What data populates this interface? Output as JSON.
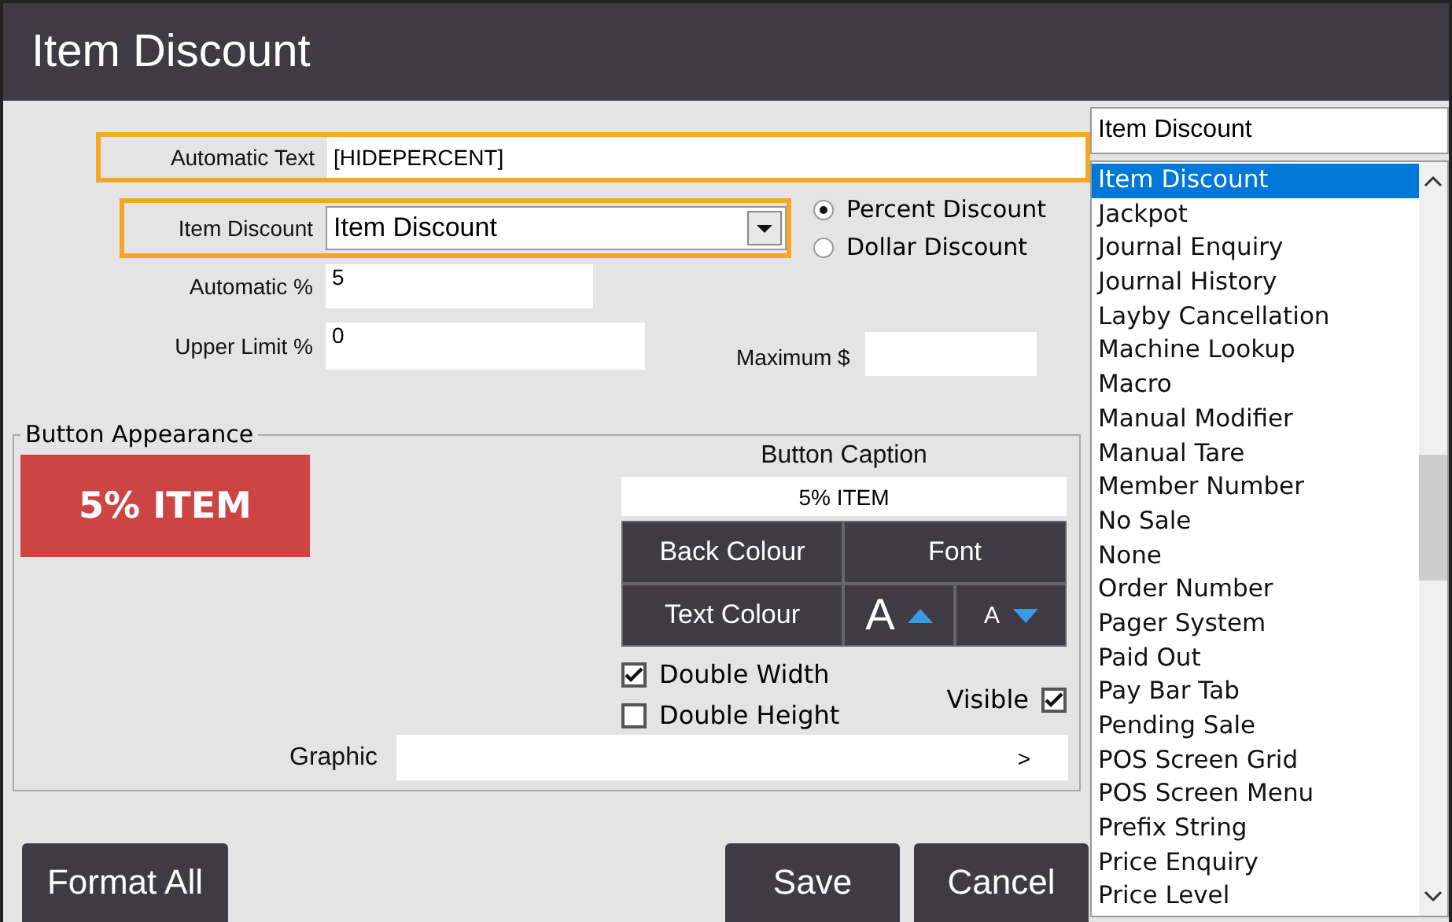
{
  "window": {
    "title": "Item Discount"
  },
  "automatic_text": {
    "label": "Automatic Text",
    "value": "[HIDEPERCENT]",
    "highlighted": true
  },
  "function_select": {
    "label": "Item Discount",
    "value": "Item Discount",
    "highlighted": true
  },
  "discount_type": [
    {
      "label": "Percent Discount",
      "selected": true
    },
    {
      "label": "Dollar Discount",
      "selected": false
    }
  ],
  "automatic_percent": {
    "label": "Automatic %",
    "value": "5"
  },
  "upper_limit": {
    "label": "Upper Limit %",
    "value": "0"
  },
  "maximum": {
    "label": "Maximum $"
  },
  "appearance": {
    "title": "Button Appearance",
    "preview": "5% ITEM",
    "caption_label": "Button Caption",
    "caption": "5% ITEM",
    "buttons": [
      {
        "kind": "text",
        "label": "Back Colour"
      },
      {
        "kind": "text",
        "label": "Font"
      },
      {
        "kind": "text",
        "label": "Text Colour"
      },
      {
        "kind": "grow",
        "label": "A"
      },
      {
        "kind": "shrink",
        "label": "A"
      }
    ],
    "options": [
      {
        "label": "Double Width",
        "checked": true
      },
      {
        "label": "Double Height",
        "checked": false
      }
    ],
    "visible": {
      "label": "Visible",
      "checked": true
    },
    "graphic": {
      "label": "Graphic",
      "browse": ">"
    }
  },
  "footer": [
    {
      "label": "Format All"
    },
    {
      "label": "Save"
    },
    {
      "label": "Cancel"
    }
  ],
  "function_list": {
    "search": "Item Discount",
    "items": [
      {
        "label": "Item Discount",
        "selected": true
      },
      {
        "label": "Jackpot",
        "selected": false
      },
      {
        "label": "Journal Enquiry",
        "selected": false
      },
      {
        "label": "Journal History",
        "selected": false
      },
      {
        "label": "Layby Cancellation",
        "selected": false
      },
      {
        "label": "Machine Lookup",
        "selected": false
      },
      {
        "label": "Macro",
        "selected": false
      },
      {
        "label": "Manual Modifier",
        "selected": false
      },
      {
        "label": "Manual Tare",
        "selected": false
      },
      {
        "label": "Member Number",
        "selected": false
      },
      {
        "label": "No Sale",
        "selected": false
      },
      {
        "label": "None",
        "selected": false
      },
      {
        "label": "Order Number",
        "selected": false
      },
      {
        "label": "Pager System",
        "selected": false
      },
      {
        "label": "Paid Out",
        "selected": false
      },
      {
        "label": "Pay Bar Tab",
        "selected": false
      },
      {
        "label": "Pending Sale",
        "selected": false
      },
      {
        "label": "POS Screen Grid",
        "selected": false
      },
      {
        "label": "POS Screen Menu",
        "selected": false
      },
      {
        "label": "Prefix String",
        "selected": false
      },
      {
        "label": "Price Enquiry",
        "selected": false
      },
      {
        "label": "Price Level",
        "selected": false
      }
    ]
  }
}
